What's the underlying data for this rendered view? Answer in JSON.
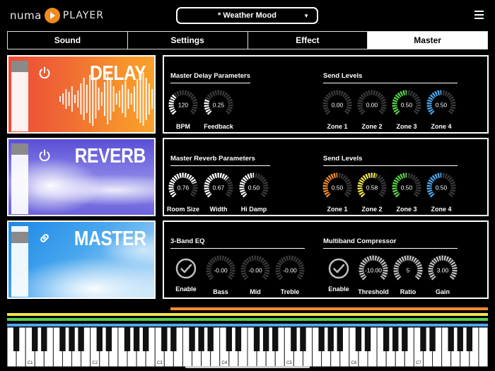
{
  "header": {
    "logo_left": "numa",
    "logo_right": "PLAYER",
    "preset_name": "* Weather Mood",
    "menu_icon": "hamburger-icon"
  },
  "tabs": [
    {
      "label": "Sound",
      "active": false
    },
    {
      "label": "Settings",
      "active": false
    },
    {
      "label": "Effect",
      "active": false
    },
    {
      "label": "Master",
      "active": true
    }
  ],
  "effects": [
    {
      "label": "DELAY",
      "icon": "power-icon",
      "fader_level": 0.85
    },
    {
      "label": "REVERB",
      "icon": "power-icon",
      "fader_level": 0.85
    },
    {
      "label": "MASTER",
      "icon": "link-icon",
      "fader_level": 0.75
    }
  ],
  "delay": {
    "title": "Master Delay Parameters",
    "knobs": [
      {
        "label": "BPM",
        "value": "120",
        "fill": 0.35,
        "color": "#ffffff"
      },
      {
        "label": "Feedback",
        "value": "0.25",
        "fill": 0.25,
        "color": "#ffffff"
      }
    ],
    "send_title": "Send Levels",
    "sends": [
      {
        "label": "Zone 1",
        "value": "0.00",
        "fill": 0.0,
        "color": "#f58a2a"
      },
      {
        "label": "Zone 2",
        "value": "0.00",
        "fill": 0.0,
        "color": "#f2e64a"
      },
      {
        "label": "Zone 3",
        "value": "0.50",
        "fill": 0.5,
        "color": "#5ad24a"
      },
      {
        "label": "Zone 4",
        "value": "0.50",
        "fill": 0.5,
        "color": "#4aa8f0"
      }
    ]
  },
  "reverb": {
    "title": "Master Reverb Parameters",
    "knobs": [
      {
        "label": "Room Size",
        "value": "0.76",
        "fill": 0.76,
        "color": "#ffffff"
      },
      {
        "label": "Width",
        "value": "0.67",
        "fill": 0.67,
        "color": "#ffffff"
      },
      {
        "label": "Hi Damp",
        "value": "0.50",
        "fill": 0.5,
        "color": "#ffffff"
      }
    ],
    "send_title": "Send Levels",
    "sends": [
      {
        "label": "Zone 1",
        "value": "0.50",
        "fill": 0.5,
        "color": "#f58a2a"
      },
      {
        "label": "Zone 2",
        "value": "0.58",
        "fill": 0.58,
        "color": "#f2e64a"
      },
      {
        "label": "Zone 3",
        "value": "0.50",
        "fill": 0.5,
        "color": "#5ad24a"
      },
      {
        "label": "Zone 4",
        "value": "0.50",
        "fill": 0.5,
        "color": "#4aa8f0"
      }
    ]
  },
  "master": {
    "eq_title": "3-Band EQ",
    "eq_enable_label": "Enable",
    "eq_knobs": [
      {
        "label": "Bass",
        "value": "-0.00",
        "fill": 0.0,
        "color": "#ffffff"
      },
      {
        "label": "Mid",
        "value": "-0.00",
        "fill": 0.0,
        "color": "#ffffff"
      },
      {
        "label": "Treble",
        "value": "-0.00",
        "fill": 0.0,
        "color": "#ffffff"
      }
    ],
    "comp_title": "Multiband Compressor",
    "comp_enable_label": "Enable",
    "comp_knobs": [
      {
        "label": "Threshold",
        "value": "-10.00",
        "fill": 1.0,
        "color": "#bdbdbd"
      },
      {
        "label": "Ratio",
        "value": "5",
        "fill": 1.0,
        "color": "#bdbdbd"
      },
      {
        "label": "Gain",
        "value": "3.00",
        "fill": 1.0,
        "color": "#bdbdbd"
      }
    ]
  },
  "zones": [
    {
      "color": "#f58a2a",
      "range_start": 0.34,
      "range_end": 1.0
    },
    {
      "color": "#f2e64a",
      "range_start": 0.0,
      "range_end": 1.0
    },
    {
      "color": "#5ad24a",
      "range_start": 0.0,
      "range_end": 1.0
    },
    {
      "color": "#4aa8f0",
      "range_start": 0.0,
      "range_end": 1.0
    }
  ],
  "keyboard": {
    "octave_labels": [
      "C1",
      "C2",
      "C3",
      "C4",
      "C5",
      "C6",
      "C7"
    ]
  }
}
